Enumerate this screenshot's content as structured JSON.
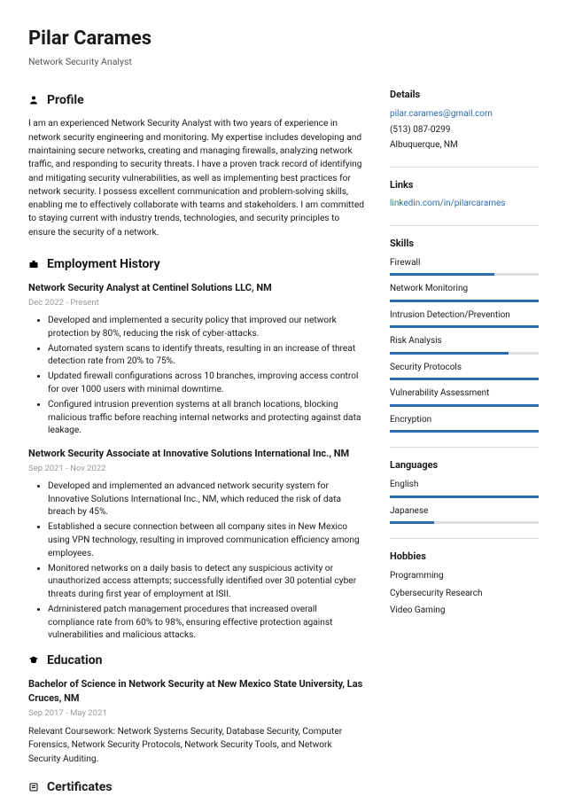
{
  "name": "Pilar Carames",
  "title": "Network Security Analyst",
  "sections": {
    "profile": "Profile",
    "employment": "Employment History",
    "education": "Education",
    "certificates": "Certificates",
    "details": "Details",
    "links": "Links",
    "skills": "Skills",
    "languages": "Languages",
    "hobbies": "Hobbies"
  },
  "profile_text": "I am an experienced Network Security Analyst with two years of experience in network security engineering and monitoring. My expertise includes developing and maintaining secure networks, creating and managing firewalls, analyzing network traffic, and responding to security threats. I have a proven track record of identifying and mitigating security vulnerabilities, as well as implementing best practices for network security. I possess excellent communication and problem-solving skills, enabling me to effectively collaborate with teams and stakeholders. I am committed to staying current with industry trends, technologies, and security principles to ensure the security of a network.",
  "jobs": [
    {
      "title": "Network Security Analyst at Centinel Solutions LLC, NM",
      "date": "Dec 2022 - Present",
      "bullets": [
        "Developed and implemented a security policy that improved our network protection by 80%, reducing the risk of cyber-attacks.",
        "Automated system scans to identify threats, resulting in an increase of threat detection rate from 20% to 75%.",
        "Updated firewall configurations across 10 branches, improving access control for over 1000 users with minimal downtime.",
        "Configured intrusion prevention systems at all branch locations, blocking malicious traffic before reaching internal networks and protecting against data leakage."
      ]
    },
    {
      "title": "Network Security Associate at Innovative Solutions International Inc., NM",
      "date": "Sep 2021 - Nov 2022",
      "bullets": [
        "Developed and implemented an advanced network security system for Innovative Solutions International Inc., NM, which reduced the risk of data breach by 45%.",
        "Established a secure connection between all company sites in New Mexico using VPN technology, resulting in improved communication efficiency among employees.",
        "Monitored networks on a daily basis to detect any suspicious activity or unauthorized access attempts; successfully identified over 30 potential cyber threats during first year of employment at ISII.",
        "Administered patch management procedures that increased overall compliance rate from 60% to 98%, ensuring effective protection against vulnerabilities and malicious attacks."
      ]
    }
  ],
  "education": {
    "title": "Bachelor of Science in Network Security at New Mexico State University, Las Cruces, NM",
    "date": "Sep 2017 - May 2021",
    "text": "Relevant Coursework: Network Systems Security, Database Security, Computer Forensics, Network Security Protocols, Network Security Tools, and Network Security Auditing."
  },
  "details": {
    "email": "pilar.carames@gmail.com",
    "phone": "(513) 087-0299",
    "location": "Albuquerque, NM"
  },
  "links": {
    "linkedin": "linkedin.com/in/pilarcarames"
  },
  "skills": [
    {
      "name": "Firewall",
      "level": 70
    },
    {
      "name": "Network Monitoring",
      "level": 100
    },
    {
      "name": "Intrusion Detection/Prevention",
      "level": 100
    },
    {
      "name": "Risk Analysis",
      "level": 80
    },
    {
      "name": "Security Protocols",
      "level": 100
    },
    {
      "name": "Vulnerability Assessment",
      "level": 100
    },
    {
      "name": "Encryption",
      "level": 100
    }
  ],
  "languages": [
    {
      "name": "English",
      "level": 100
    },
    {
      "name": "Japanese",
      "level": 30
    }
  ],
  "hobbies": [
    "Programming",
    "Cybersecurity Research",
    "Video Gaming"
  ]
}
